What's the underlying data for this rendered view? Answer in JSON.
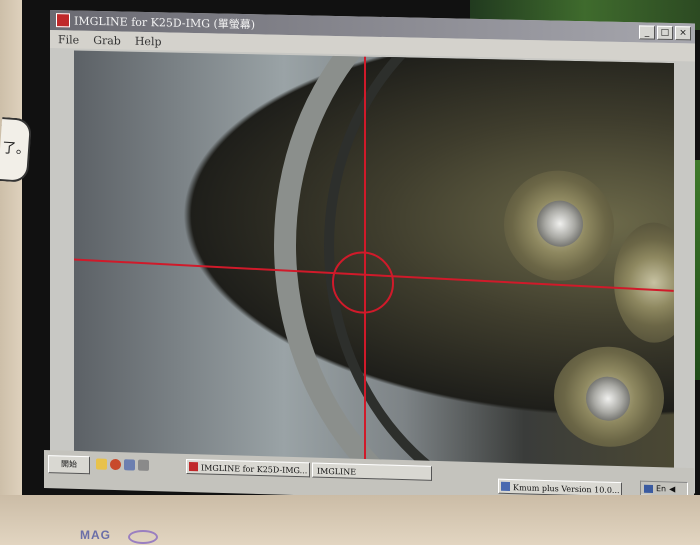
{
  "window": {
    "title": "IMGLINE for K25D-IMG (單螢幕)",
    "controls": [
      "_",
      "□",
      "×"
    ]
  },
  "menu": {
    "items": [
      "File",
      "Grab",
      "Help"
    ]
  },
  "viewport": {
    "crosshair_color": "#d01a2a"
  },
  "taskbar": {
    "start_label": "開始",
    "tasks": [
      {
        "label": "IMGLINE for K25D-IMG..."
      },
      {
        "label": "IMGLINE"
      },
      {
        "label": "Kmum plus Version 10.0..."
      }
    ],
    "tray_lang": "En"
  },
  "monitor": {
    "brand": "MAG",
    "sticker_text": "了。"
  },
  "icons": [
    "app-icon",
    "minimize-icon",
    "maximize-icon",
    "close-icon",
    "folder-icon",
    "browser-icon",
    "network-icon",
    "media-icon"
  ]
}
